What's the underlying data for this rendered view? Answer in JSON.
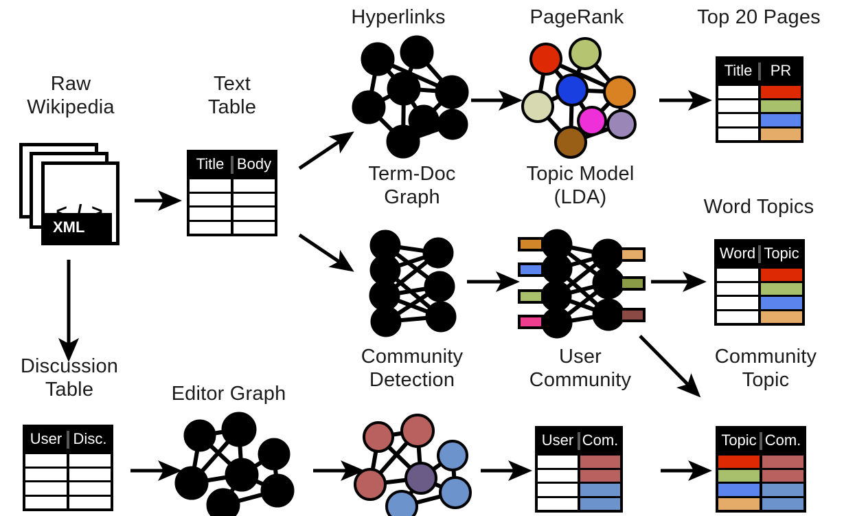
{
  "diagram": {
    "title_hidden": "",
    "labels": {
      "raw_wikipedia": "Raw\nWikipedia",
      "text_table": "Text\nTable",
      "hyperlinks": "Hyperlinks",
      "pagerank": "PageRank",
      "top20": "Top 20 Pages",
      "term_doc_graph": "Term-Doc\nGraph",
      "topic_model": "Topic Model\n(LDA)",
      "word_topics": "Word Topics",
      "discussion_table": "Discussion\nTable",
      "editor_graph": "Editor Graph",
      "community_detection": "Community\nDetection",
      "user_community": "User\nCommunity",
      "community_topic": "Community\nTopic"
    },
    "xml_doc": {
      "code_glyph": "< / >",
      "format_badge": "XML"
    },
    "tables": [
      {
        "id": "text-table",
        "headers": [
          "Title",
          "Body"
        ],
        "rows": [
          {
            "left": "#ffffff",
            "right": "#ffffff"
          },
          {
            "left": "#ffffff",
            "right": "#ffffff"
          },
          {
            "left": "#ffffff",
            "right": "#ffffff"
          },
          {
            "left": "#ffffff",
            "right": "#ffffff"
          }
        ]
      },
      {
        "id": "top20-table",
        "headers": [
          "Title",
          "PR"
        ],
        "rows": [
          {
            "left": "#ffffff",
            "right": "#dd2a05"
          },
          {
            "left": "#ffffff",
            "right": "#a8bf6b"
          },
          {
            "left": "#ffffff",
            "right": "#5b84ed"
          },
          {
            "left": "#ffffff",
            "right": "#e5ab69"
          }
        ]
      },
      {
        "id": "word-topics-table",
        "headers": [
          "Word",
          "Topic"
        ],
        "rows": [
          {
            "left": "#ffffff",
            "right": "#dd2a05"
          },
          {
            "left": "#ffffff",
            "right": "#a8bf6b"
          },
          {
            "left": "#ffffff",
            "right": "#5b84ed"
          },
          {
            "left": "#ffffff",
            "right": "#e5ab69"
          }
        ]
      },
      {
        "id": "discussion-table",
        "headers": [
          "User",
          "Disc."
        ],
        "rows": [
          {
            "left": "#ffffff",
            "right": "#ffffff"
          },
          {
            "left": "#ffffff",
            "right": "#ffffff"
          },
          {
            "left": "#ffffff",
            "right": "#ffffff"
          },
          {
            "left": "#ffffff",
            "right": "#ffffff"
          }
        ]
      },
      {
        "id": "user-community-table",
        "headers": [
          "User",
          "Com."
        ],
        "rows": [
          {
            "left": "#ffffff",
            "right": "#b9615e"
          },
          {
            "left": "#ffffff",
            "right": "#b9615e"
          },
          {
            "left": "#ffffff",
            "right": "#6d93cc"
          },
          {
            "left": "#ffffff",
            "right": "#6d93cc"
          }
        ]
      },
      {
        "id": "community-topic-table",
        "headers": [
          "Topic",
          "Com."
        ],
        "rows": [
          {
            "left": "#dd2a05",
            "right": "#b9615e"
          },
          {
            "left": "#a8bf6b",
            "right": "#b9615e"
          },
          {
            "left": "#5b84ed",
            "right": "#6d93cc"
          },
          {
            "left": "#e5ab69",
            "right": "#6d93cc"
          }
        ]
      }
    ],
    "pagerank_node_colors": [
      "#dd2a05",
      "#b5c470",
      "#1a3fe0",
      "#d7d9b0",
      "#d98224",
      "#ee30d8",
      "#9a87b8",
      "#9a5f16"
    ],
    "community_node_colors": [
      "#b9615e",
      "#b9615e",
      "#b9615e",
      "#6a5b87",
      "#6d93cc",
      "#6d93cc",
      "#6d93cc"
    ],
    "lda_left_bar_colors": [
      "#d1862a",
      "#5b84ed",
      "#a8bf6b",
      "#ee3c8e"
    ],
    "lda_right_bar_colors": [
      "#e5ab69",
      "#8a9c46",
      "#8c4a45"
    ],
    "graph_node_fill": "#000000"
  }
}
